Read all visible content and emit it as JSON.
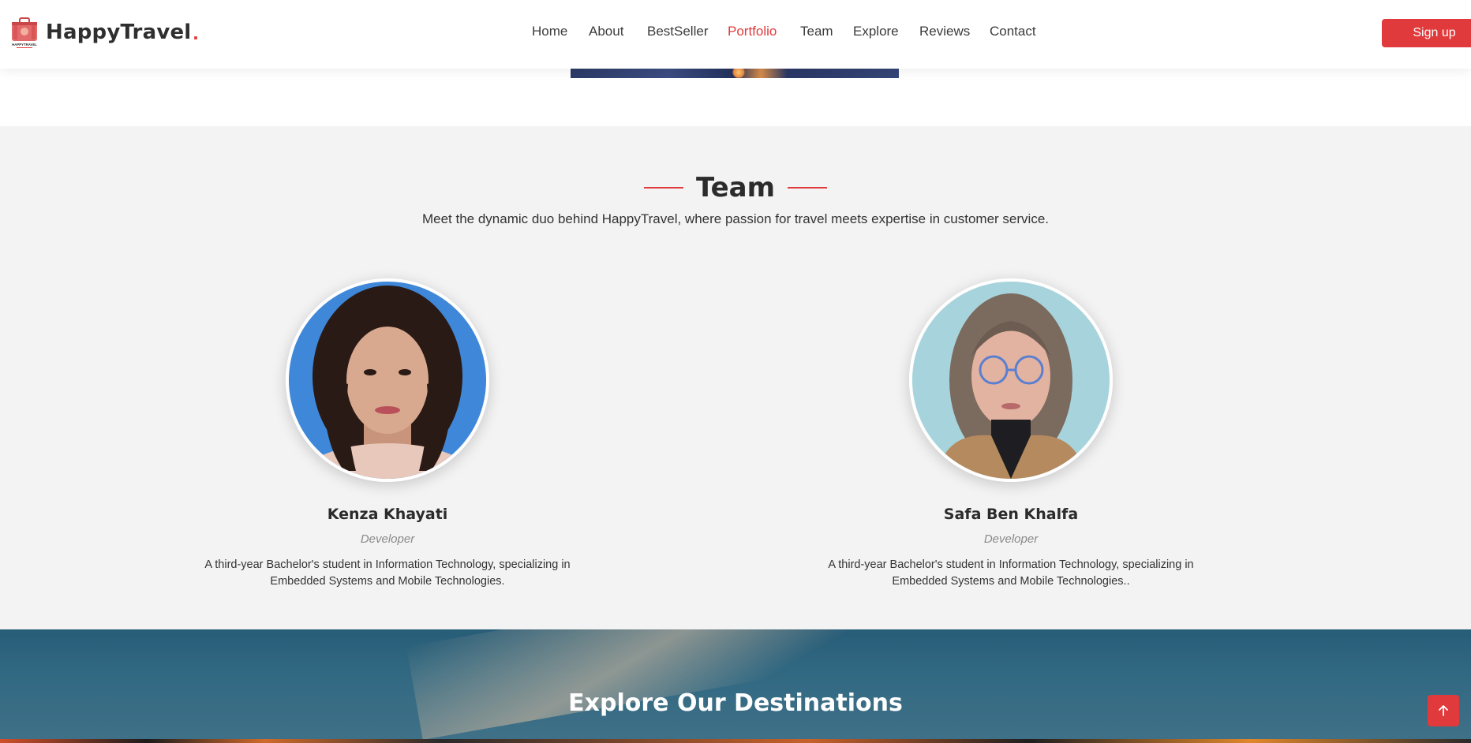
{
  "brand": {
    "name": "HappyTravel",
    "dot": ".",
    "logo_text": "HAPPYTRAVEL"
  },
  "nav": {
    "items": [
      {
        "label": "Home"
      },
      {
        "label": "About"
      },
      {
        "label": "BestSeller"
      },
      {
        "label": "Portfolio",
        "active": true
      },
      {
        "label": "Team"
      },
      {
        "label": "Explore"
      },
      {
        "label": "Reviews"
      },
      {
        "label": "Contact"
      }
    ],
    "signup_label": "Sign up"
  },
  "team": {
    "title": "Team",
    "subtitle": "Meet the dynamic duo behind HappyTravel, where passion for travel meets expertise in customer service.",
    "members": [
      {
        "name": "Kenza Khayati",
        "role": "Developer",
        "description": "A third-year Bachelor's student in Information Technology, specializing in Embedded Systems and Mobile Technologies."
      },
      {
        "name": "Safa Ben Khalfa",
        "role": "Developer",
        "description": "A third-year Bachelor's student in Information Technology, specializing in Embedded Systems and Mobile Technologies.."
      }
    ]
  },
  "explore": {
    "title": "Explore Our Destinations"
  },
  "colors": {
    "accent": "#e03a3c",
    "section_bg": "#f3f3f3",
    "text_dark": "#2b2b2b"
  },
  "icons": {
    "logo": "suitcase-icon",
    "back_to_top": "arrow-up-icon"
  }
}
